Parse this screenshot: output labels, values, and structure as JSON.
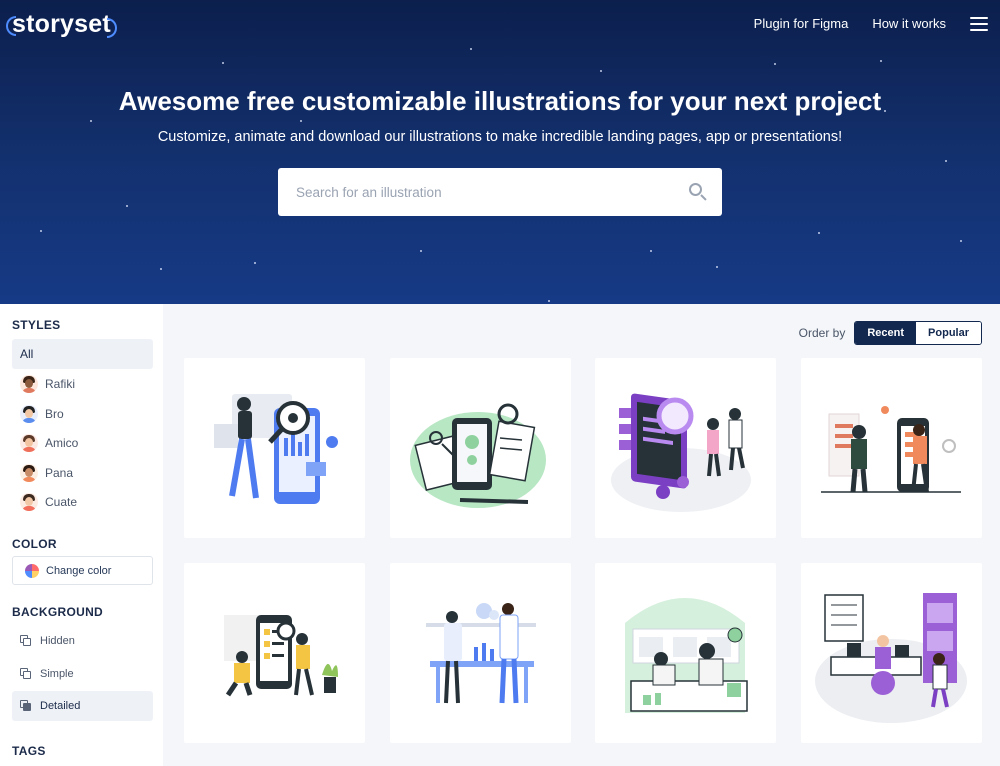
{
  "header": {
    "logo": "storyset",
    "nav": [
      "Plugin for Figma",
      "How it works"
    ]
  },
  "hero": {
    "title": "Awesome free customizable illustrations for your next project",
    "subtitle": "Customize, animate and download our illustrations to make incredible landing pages, app or presentations!",
    "search_placeholder": "Search for an illustration"
  },
  "sidebar": {
    "styles_title": "STYLES",
    "styles": [
      {
        "label": "All",
        "icon": ""
      },
      {
        "label": "Rafiki",
        "icon": "rafiki-avatar"
      },
      {
        "label": "Bro",
        "icon": "bro-avatar"
      },
      {
        "label": "Amico",
        "icon": "amico-avatar"
      },
      {
        "label": "Pana",
        "icon": "pana-avatar"
      },
      {
        "label": "Cuate",
        "icon": "cuate-avatar"
      }
    ],
    "color_title": "COLOR",
    "change_color": "Change color",
    "background_title": "BACKGROUND",
    "backgrounds": [
      "Hidden",
      "Simple",
      "Detailed"
    ],
    "tags_title": "TAGS"
  },
  "order": {
    "label": "Order by",
    "options": [
      "Recent",
      "Popular"
    ],
    "selected": "Recent"
  },
  "accent_colors": {
    "navy": "#12284f",
    "blue": "#4e8cff",
    "green": "#8fd19e",
    "purple": "#9b5fd6",
    "orange": "#f0845a"
  },
  "cards": [
    {
      "icon": "bug-search-illustration"
    },
    {
      "icon": "phone-settings-checklist-illustration"
    },
    {
      "icon": "code-review-team-illustration"
    },
    {
      "icon": "mobile-app-team-illustration"
    },
    {
      "icon": "phone-checklist-people-illustration"
    },
    {
      "icon": "scientists-lab-illustration"
    },
    {
      "icon": "chemistry-lab-illustration"
    },
    {
      "icon": "research-lab-office-illustration"
    }
  ]
}
